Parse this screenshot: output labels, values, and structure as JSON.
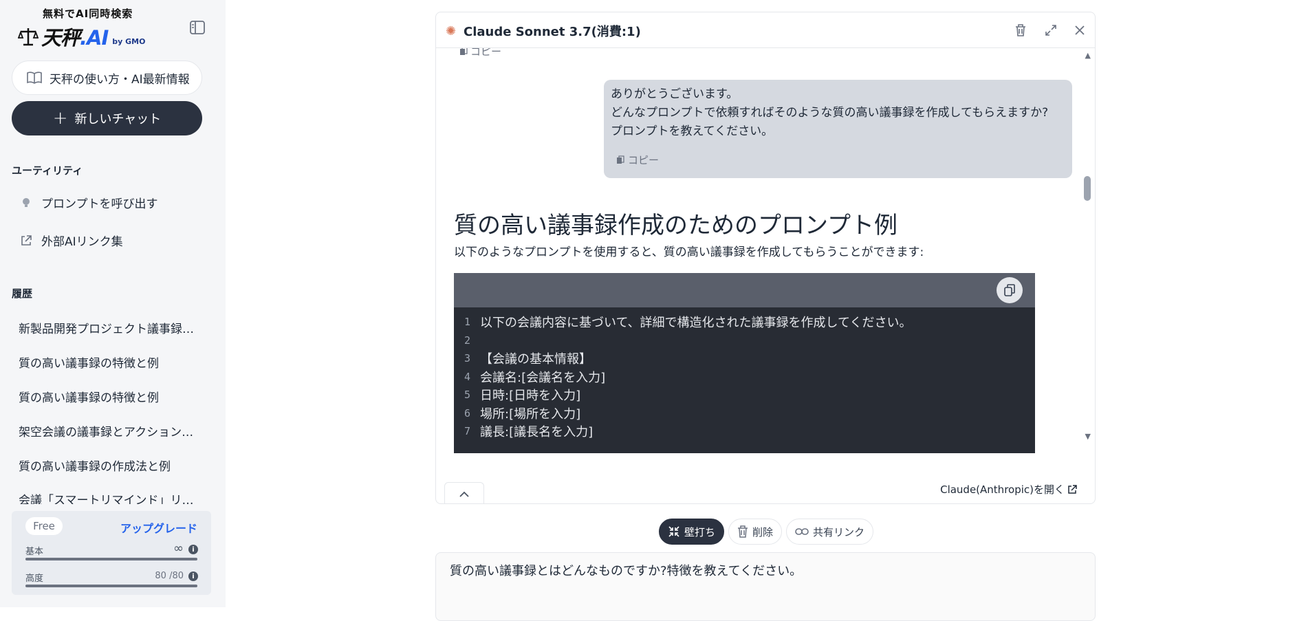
{
  "sidebar": {
    "logo_tagline": "無料でAI同時検索",
    "logo_name": "天秤",
    "logo_ai": ".AI",
    "logo_by": "by GMO",
    "howto_label": "天秤の使い方・AI最新情報",
    "new_chat_label": "新しいチャット",
    "utility_title": "ユーティリティ",
    "utility_items": [
      "プロンプトを呼び出す",
      "外部AIリンク集"
    ],
    "history_title": "履歴",
    "history_items": [
      "新製品開発プロジェクト議事録…",
      "質の高い議事録の特徴と例",
      "質の高い議事録の特徴と例",
      "架空会議の議事録とアクション…",
      "質の高い議事録の作成法と例",
      "会議「スマートリマインド」リリ…"
    ],
    "plan": {
      "tier": "Free",
      "upgrade_label": "アップグレード",
      "basic_label": "基本",
      "basic_value": "∞",
      "basic_fraction": 1.0,
      "advanced_label": "高度",
      "advanced_value": "80 /80",
      "advanced_fraction": 1.0
    }
  },
  "panel": {
    "model_name": "Claude Sonnet 3.7(消費:1)",
    "copy_label": "コピー",
    "user_message": [
      "ありがとうございます。",
      "どんなプロンプトで依頼すればそのような質の高い議事録を作成してもらえますか?",
      "プロンプトを教えてください。"
    ],
    "reply_heading": "質の高い議事録作成のためのプロンプト例",
    "reply_intro": "以下のようなプロンプトを使用すると、質の高い議事録を作成してもらうことができます:",
    "code_lines": [
      {
        "n": "1",
        "text": "以下の会議内容に基づいて、詳細で構造化された議事録を作成してください。"
      },
      {
        "n": "2",
        "text": ""
      },
      {
        "n": "3",
        "text": "【会議の基本情報】"
      },
      {
        "n": "4",
        "text": "会議名:[会議名を入力]"
      },
      {
        "n": "5",
        "text": "日時:[日時を入力]"
      },
      {
        "n": "6",
        "text": "場所:[場所を入力]"
      },
      {
        "n": "7",
        "text": "議長:[議長名を入力]"
      }
    ],
    "open_link_label": "Claude(Anthropic)を開く"
  },
  "actions": {
    "wall_label": "壁打ち",
    "delete_label": "削除",
    "share_label": "共有リンク"
  },
  "input": {
    "value": "質の高い議事録とはどんなものですか?特徴を教えてください。"
  }
}
